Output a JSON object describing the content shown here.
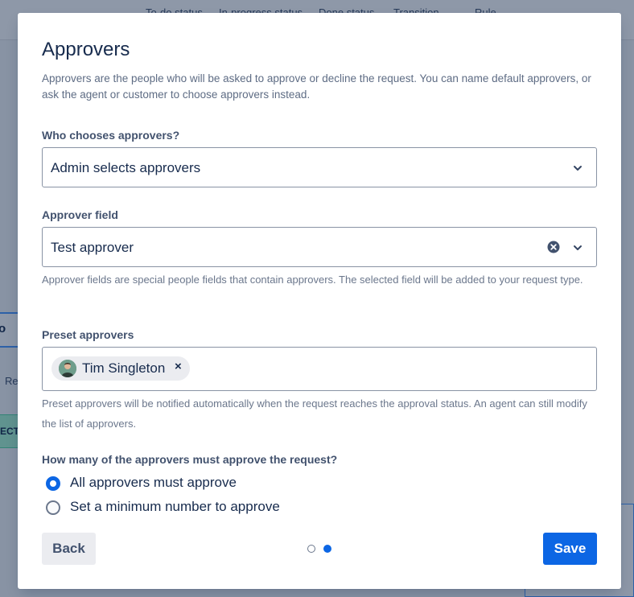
{
  "background": {
    "columns": [
      "To-do status",
      "In-progress status",
      "Done status",
      "Transition",
      "Rule"
    ],
    "node_text": "o",
    "re_text": "Re",
    "box_text": "ECT"
  },
  "modal": {
    "title": "Approvers",
    "description": "Approvers are the people who will be asked to approve or decline the request. You can name default approvers, or ask the agent or customer to choose approvers instead.",
    "who_chooses": {
      "label": "Who chooses approvers?",
      "value": "Admin selects approvers",
      "icon": "chevron-down-icon"
    },
    "approver_field": {
      "label": "Approver field",
      "value": "Test approver",
      "clear_icon": "clear-icon",
      "icon": "chevron-down-icon",
      "help": "Approver fields are special people fields that contain approvers. The selected field will be added to your request type."
    },
    "preset_approvers": {
      "label": "Preset approvers",
      "chips": [
        {
          "name": "Tim Singleton",
          "remove": "×"
        }
      ],
      "help": "Preset approvers will be notified automatically when the request reaches the approval status. An agent can still modify the list of approvers."
    },
    "how_many": {
      "label": "How many of the approvers must approve the request?",
      "options": [
        {
          "label": "All approvers must approve",
          "checked": true
        },
        {
          "label": "Set a minimum number to approve",
          "checked": false
        }
      ]
    },
    "footer": {
      "back_label": "Back",
      "save_label": "Save",
      "pagination": {
        "current": 2,
        "total": 2
      }
    }
  },
  "colors": {
    "primary": "#0c66e4",
    "text": "#172b4d",
    "subtle_text": "#6b778c",
    "border": "#8993a4"
  }
}
